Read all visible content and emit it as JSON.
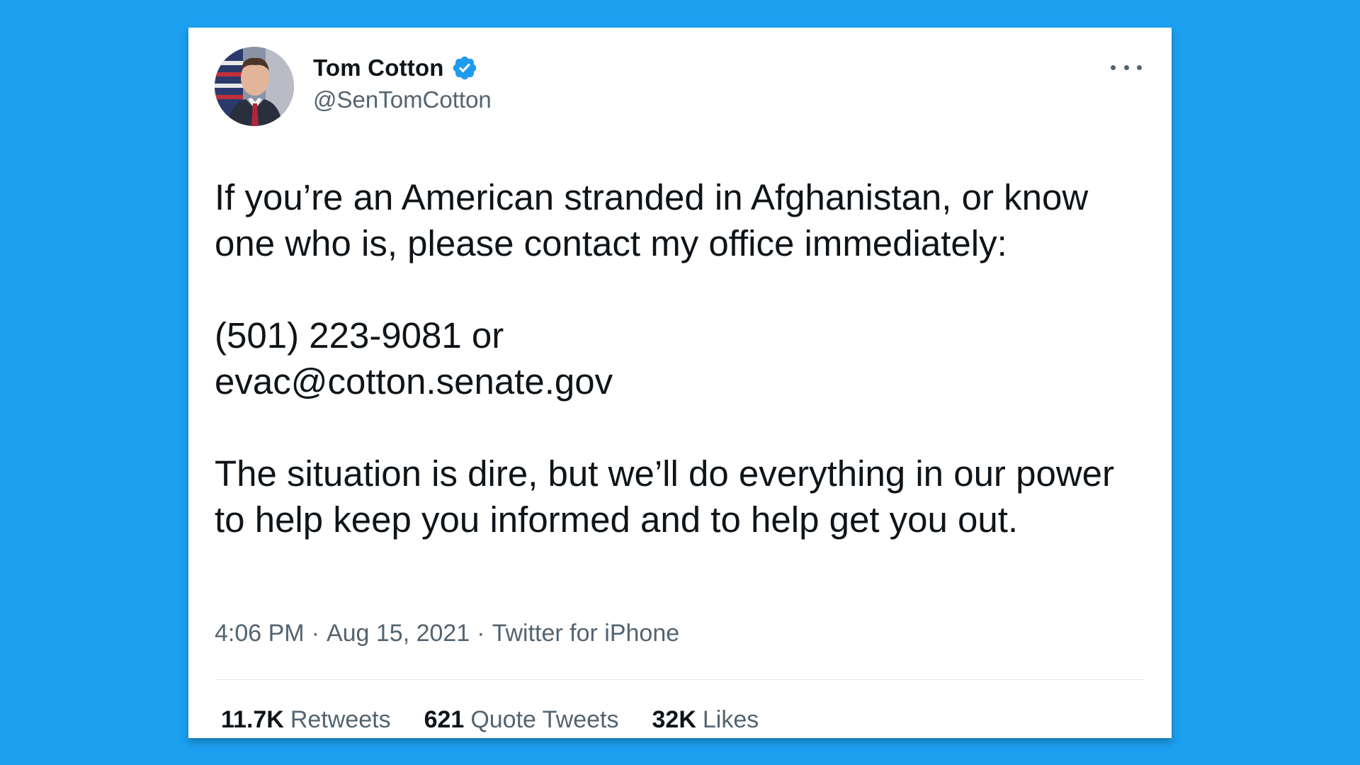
{
  "tweet": {
    "author": {
      "name": "Tom Cotton",
      "handle": "@SenTomCotton",
      "verified": true
    },
    "text": {
      "paragraph1": "If you’re an American stranded in Afghanistan, or know one who is, please contact my office immediately:",
      "paragraph2_line1": "(501) 223-9081 or",
      "paragraph2_line2": "evac@cotton.senate.gov",
      "paragraph3": "The situation is dire, but we’ll do everything in our power to help keep you informed and to help get you out."
    },
    "time": "4:06 PM",
    "date": "Aug 15, 2021",
    "source": "Twitter for iPhone",
    "separator": "·",
    "stats": [
      {
        "count": "11.7K",
        "label": "Retweets"
      },
      {
        "count": "621",
        "label": "Quote Tweets"
      },
      {
        "count": "32K",
        "label": "Likes"
      }
    ]
  },
  "icons": {
    "verified": "verified-badge-icon",
    "more": "more-options-icon"
  },
  "colors": {
    "background": "#1d9ff0",
    "text_primary": "#0f1419",
    "text_secondary": "#536471",
    "verified_badge": "#1d9bf0"
  }
}
